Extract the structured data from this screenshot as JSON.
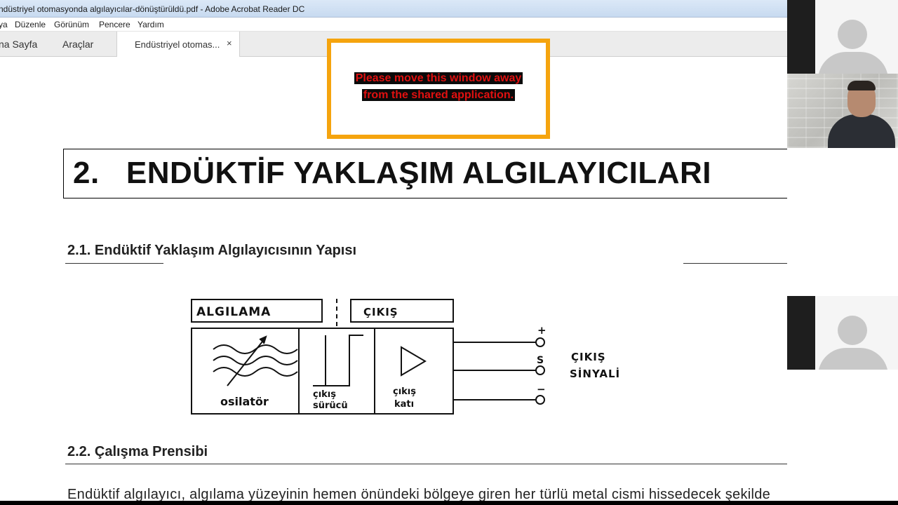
{
  "window": {
    "title": "ndüstriyel otomasyonda algılayıcılar-dönüştürüldü.pdf - Adobe Acrobat Reader DC"
  },
  "menu": [
    "ya",
    "Düzenle",
    "Görünüm",
    "Pencere",
    "Yardım"
  ],
  "tabs": {
    "home": "na Sayfa",
    "tools": "Araçlar",
    "document": "Endüstriyel otomas...",
    "close": "×"
  },
  "warning": {
    "line1": "Please move this window away",
    "line2": "from the shared application.",
    "colors": {
      "frame": "#f5a40e",
      "text": "#e01010"
    }
  },
  "document": {
    "chapter_title": "2.   ENDÜKTİF YAKLAŞIM ALGILAYICILARI",
    "section_1": "2.1. Endüktif Yaklaşım Algılayıcısının Yapısı",
    "section_2": "2.2. Çalışma Prensibi",
    "body_line": "Endüktif algılayıcı, algılama yüzeyinin hemen önündeki bölgeye giren her türlü metal cismi hissedecek şekilde"
  },
  "diagram": {
    "label_sensing": "ALGILAMA",
    "label_output": "ÇIKIŞ",
    "block_oscillator": "osilatör",
    "block_driver_1": "çıkış",
    "block_driver_2": "sürücü",
    "block_stage_1": "çıkış",
    "block_stage_2": "katı",
    "terminal_plus": "+",
    "terminal_s": "S",
    "terminal_minus": "−",
    "signal_1": "ÇIKIŞ",
    "signal_2": "SİNYALİ"
  },
  "participants": [
    {
      "type": "avatar",
      "icon": "user-avatar-icon"
    },
    {
      "type": "video",
      "icon": "webcam-video"
    },
    {
      "type": "avatar",
      "icon": "user-avatar-icon"
    }
  ]
}
